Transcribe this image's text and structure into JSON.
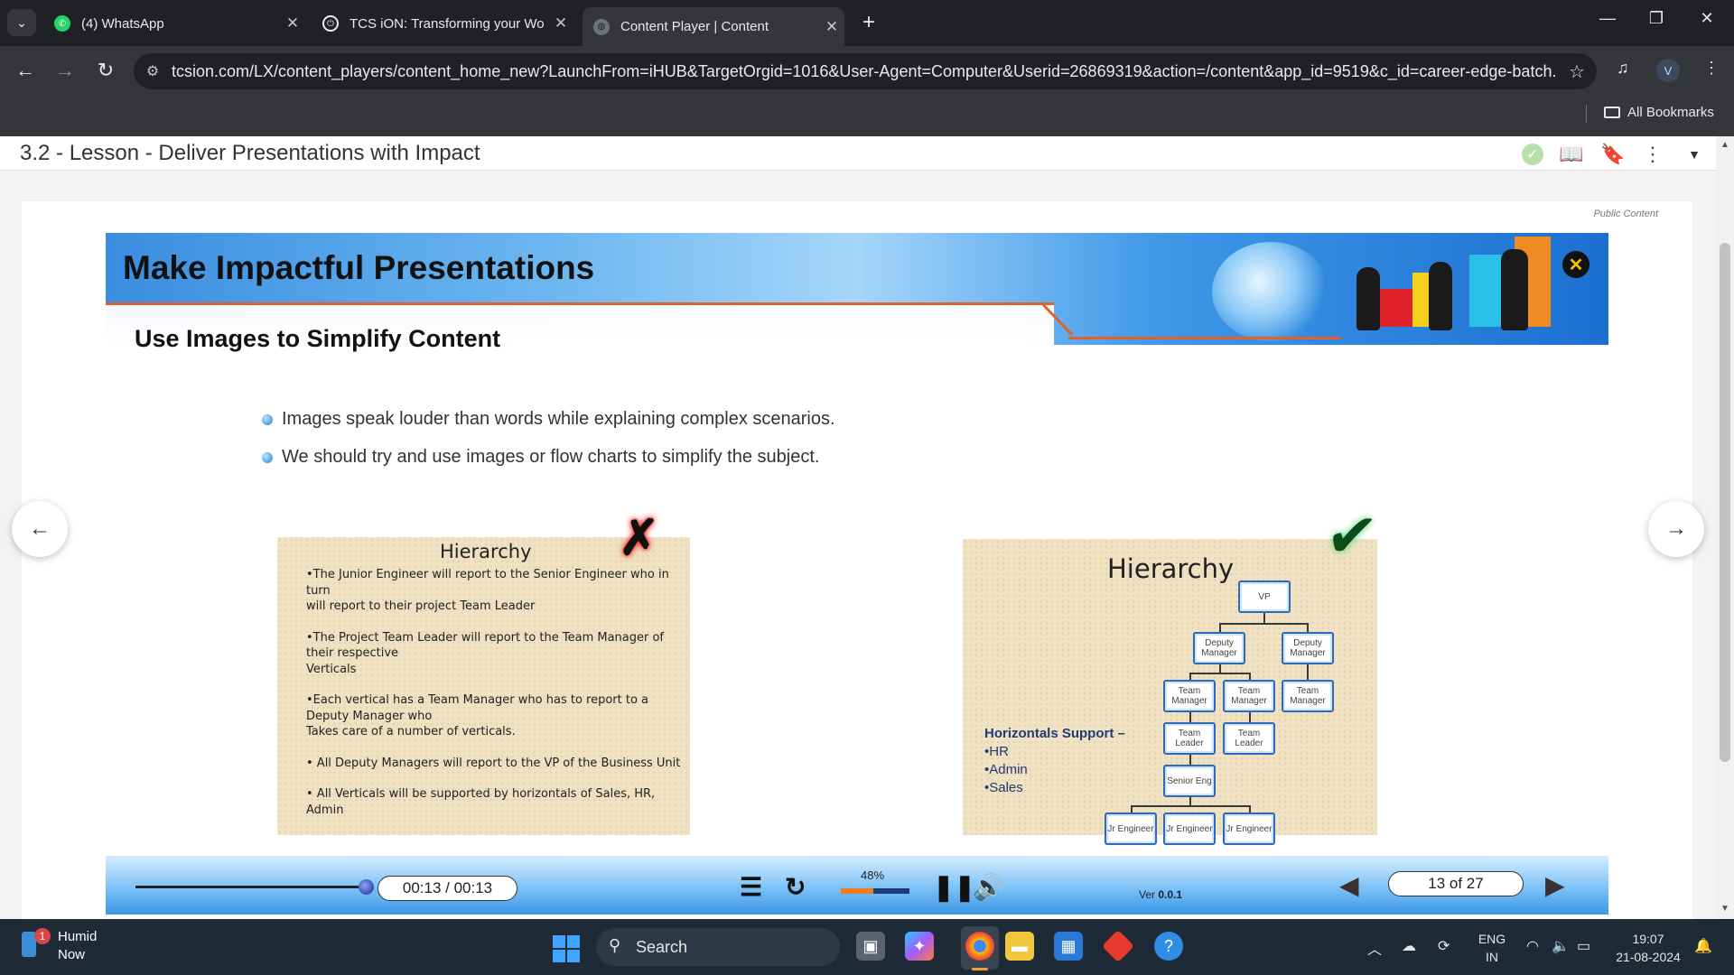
{
  "browser": {
    "tabs": [
      {
        "title": "(4) WhatsApp",
        "active": false
      },
      {
        "title": "TCS iON: Transforming your Wo",
        "active": false
      },
      {
        "title": "Content Player | Content",
        "active": true
      }
    ],
    "url": "tcsion.com/LX/content_players/content_home_new?LaunchFrom=iHUB&TargetOrgid=1016&User-Agent=Computer&Userid=26869319&action=/content&app_id=9519&c_id=career-edge-batch...",
    "profile_initial": "V",
    "bookmarks_label": "All Bookmarks"
  },
  "lesson": {
    "title": "3.2 - Lesson - Deliver Presentations with Impact",
    "public_label": "Public Content"
  },
  "slide": {
    "title": "Make Impactful Presentations",
    "subtitle": "Use Images to Simplify Content",
    "bullets": [
      "Images speak louder than words while explaining complex scenarios.",
      "We should try and use images or flow charts to simplify the subject."
    ],
    "left_image": {
      "title": "Hierarchy",
      "paragraphs": [
        "•The Junior  Engineer will report to the Senior Engineer who in turn\nwill report to their project Team Leader",
        "•The  Project Team Leader will report to the Team Manager of their respective\nVerticals",
        "•Each vertical has a Team Manager who has to report to a Deputy Manager who\nTakes care of a number of verticals.",
        "• All Deputy Managers will report to the VP of the Business Unit",
        "• All Verticals will be supported by horizontals of Sales, HR, Admin"
      ]
    },
    "right_image": {
      "title": "Hierarchy",
      "vp": "VP",
      "deputy": [
        "Deputy Manager",
        "Deputy Manager"
      ],
      "team_managers": [
        "Team Manager",
        "Team Manager",
        "Team Manager"
      ],
      "team_leaders": [
        "Team Leader",
        "Team Leader"
      ],
      "senior": "Senior Eng",
      "juniors": [
        "Jr Engineer",
        "Jr Engineer",
        "Jr Engineer"
      ],
      "support_title": "Horizontals Support –",
      "support_items": [
        "•HR",
        "•Admin",
        "•Sales"
      ]
    }
  },
  "player": {
    "time": "00:13 / 00:13",
    "volume_label": "48%",
    "volume_level": 0.48,
    "progress": 1.0,
    "version_label": "Ver ",
    "version_value": "0.0.1",
    "page": "13 of 27"
  },
  "taskbar": {
    "notification_name": "Humid",
    "notification_time": "Now",
    "notification_count": "1",
    "search_label": "Search",
    "lang1": "ENG",
    "lang2": "IN",
    "time": "19:07",
    "date": "21-08-2024"
  },
  "colors": {
    "accent_orange": "#e2612a",
    "banner_blue": "#3a8de0",
    "player_blue": "#7cc2f7"
  }
}
